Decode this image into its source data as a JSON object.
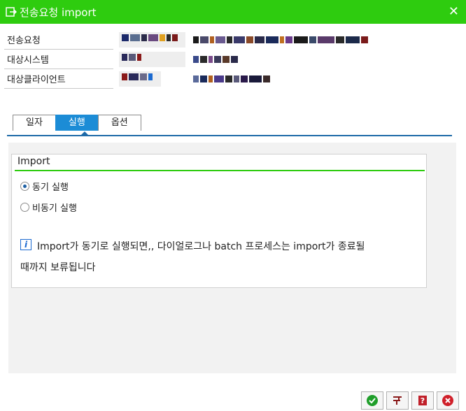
{
  "window": {
    "title": "전송요청 import",
    "close_label": "✕"
  },
  "fields": [
    {
      "label": "전송요청"
    },
    {
      "label": "대상시스템"
    },
    {
      "label": "대상클라이언트"
    }
  ],
  "tabs": [
    "일자",
    "실행",
    "옵션"
  ],
  "active_tab": "실행",
  "group": {
    "title": "Import",
    "radios": [
      {
        "label": "동기 실행",
        "selected": true
      },
      {
        "label": "비동기 실행",
        "selected": false
      }
    ],
    "info_line1": "Import가 동기로 실행되면,, 다이얼로그나 batch 프로세스는 import가 종료될",
    "info_line2": "때까지 보류됩니다"
  },
  "buttons": [
    {
      "name": "confirm",
      "icon": "check-icon"
    },
    {
      "name": "transport",
      "icon": "transport-icon"
    },
    {
      "name": "help",
      "icon": "help-icon"
    },
    {
      "name": "cancel",
      "icon": "cancel-icon"
    }
  ],
  "colors": {
    "titlebar": "#2ecc0f",
    "tab_active": "#1c8cd6",
    "accent_line": "#1e6aa8"
  }
}
